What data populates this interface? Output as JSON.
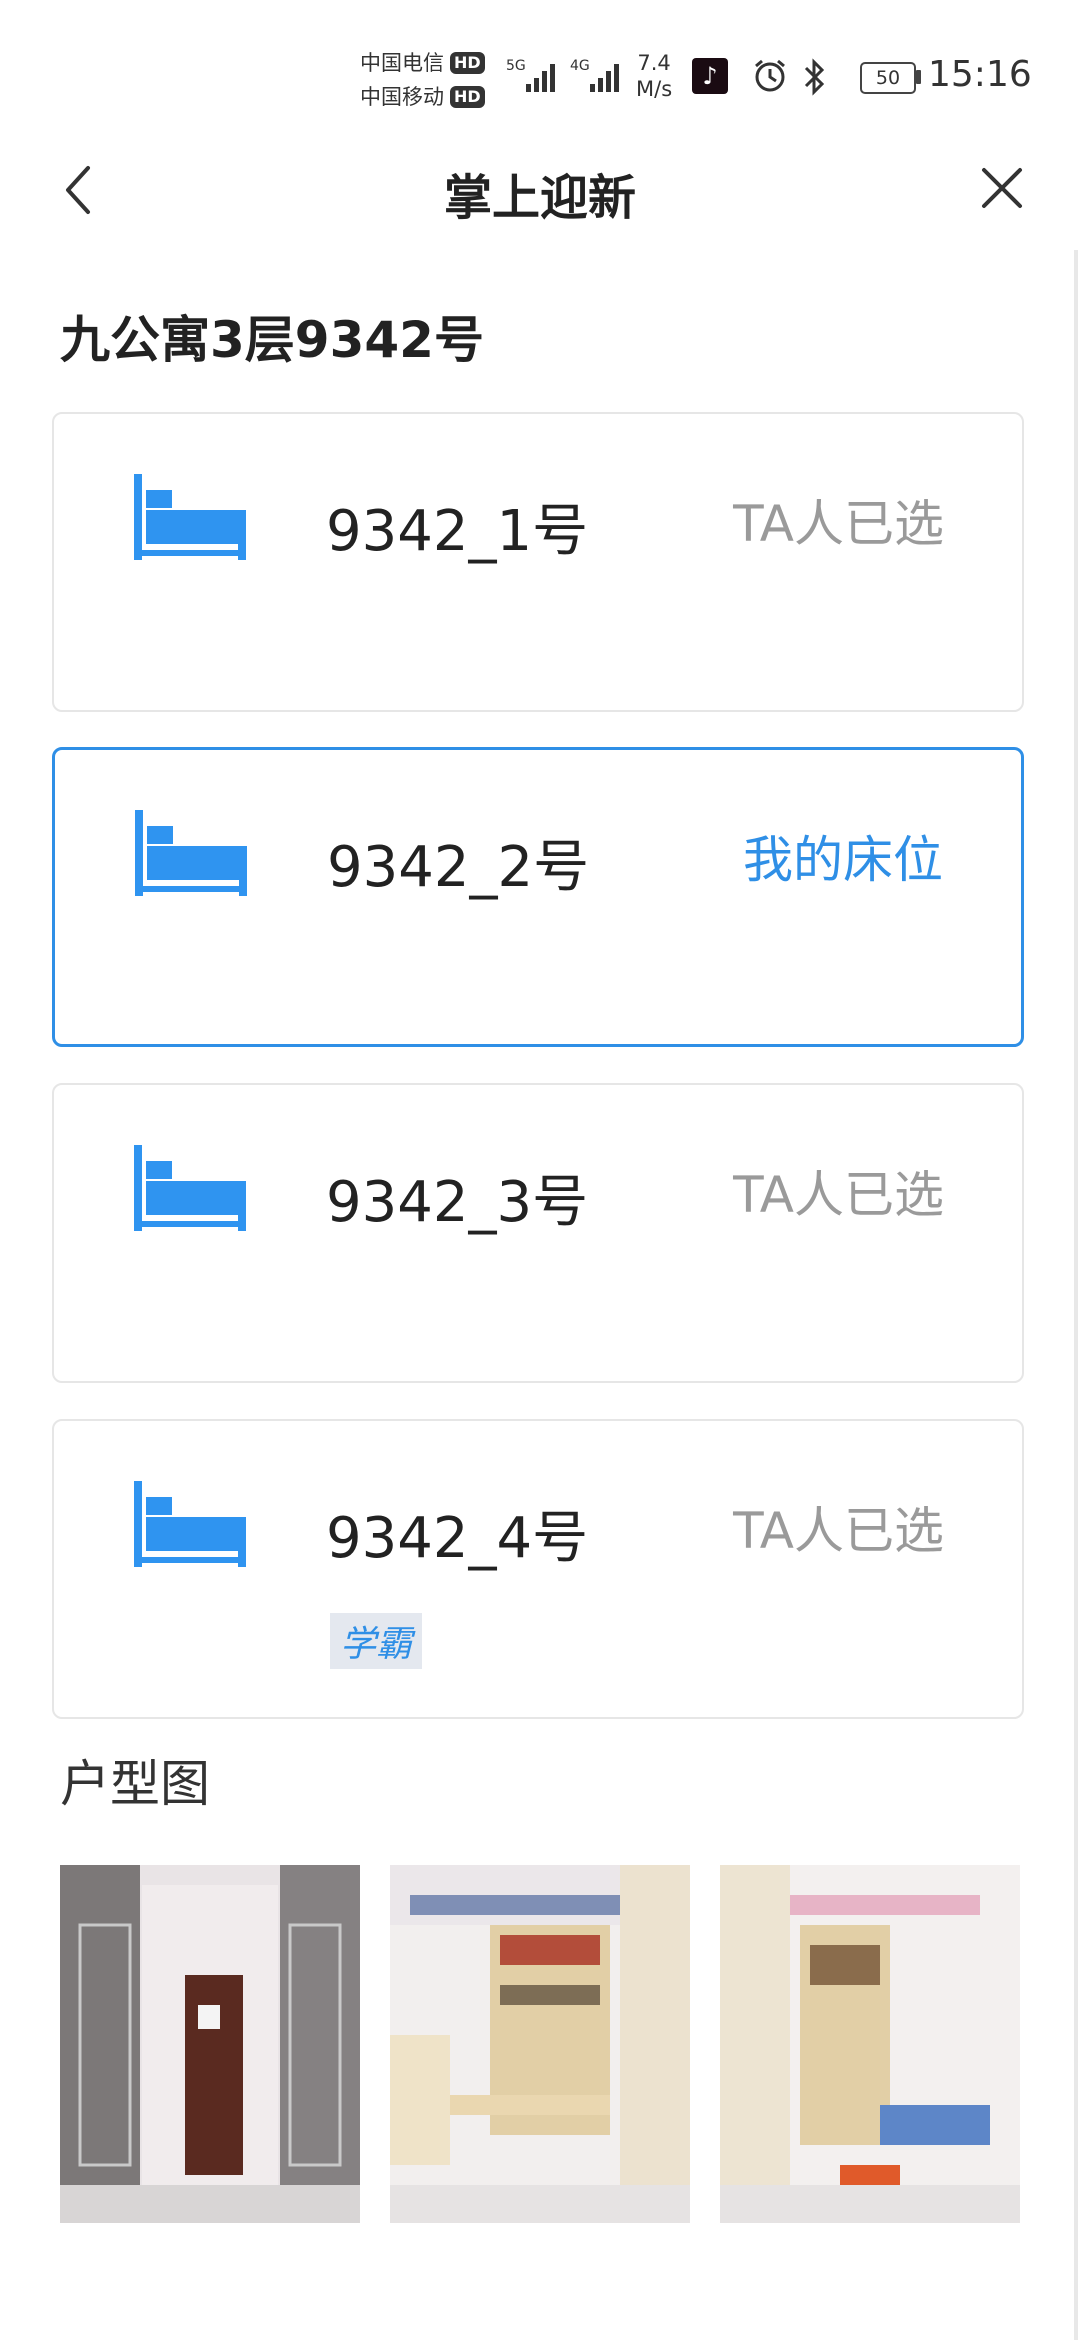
{
  "status_bar": {
    "carrier1": "中国电信",
    "carrier2": "中国移动",
    "hd_badge": "HD",
    "net5g": "5G",
    "net4g": "4G",
    "speed_value": "7.4",
    "speed_unit": "M/s",
    "battery": "50",
    "time": "15:16"
  },
  "nav": {
    "title": "掌上迎新"
  },
  "room": {
    "title": "九公寓3层9342号"
  },
  "beds": [
    {
      "name": "9342_1号",
      "status": "TA人已选"
    },
    {
      "name": "9342_2号",
      "status": "我的床位"
    },
    {
      "name": "9342_3号",
      "status": "TA人已选"
    },
    {
      "name": "9342_4号",
      "status": "TA人已选",
      "tag": "学霸"
    }
  ],
  "floor_plan": {
    "title": "户型图",
    "photos": [
      "dorm-door-view-photo",
      "dorm-desk-shelf-photo",
      "dorm-bunk-desk-photo"
    ]
  },
  "colors": {
    "accent": "#2f8fe6",
    "muted": "#9a9a9a",
    "icon": "#2f94f0"
  }
}
